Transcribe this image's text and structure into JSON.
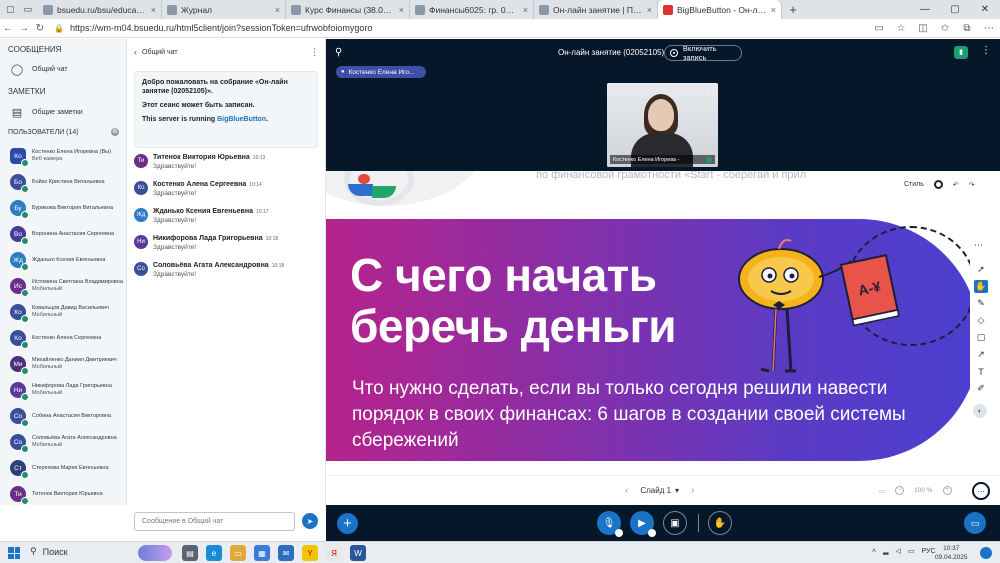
{
  "browser": {
    "tabs": [
      {
        "label": "bsuedu.ru/bsu/education/schedu",
        "active": false
      },
      {
        "label": "Журнал",
        "active": false
      },
      {
        "label": "Курс Финансы (38.03.01 Эконом",
        "active": false
      },
      {
        "label": "Финансы6025: гр. 02052105 | Пе",
        "active": false
      },
      {
        "label": "Он-лайн занятие | Пегас",
        "active": false
      },
      {
        "label": "BigBlueButton - Он-лайн за",
        "active": true
      }
    ],
    "url": "https://wm-m04.bsuedu.ru/html5client/join?sessionToken=ufrwobfoiomygoro"
  },
  "sidebar": {
    "messages_title": "СООБЩЕНИЯ",
    "public_chat": "Общий чат",
    "notes_title": "ЗАМЕТКИ",
    "shared_notes": "Общие заметки",
    "users_title": "ПОЛЬЗОВАТЕЛИ (14)",
    "users": [
      {
        "initials": "Ко",
        "name": "Костенко Елена Игоревна (Вы)",
        "sub": "Веб-камера",
        "color": "#2e4aa8",
        "self": true
      },
      {
        "initials": "Бо",
        "name": "Бойко Кристина Витальевна",
        "sub": "",
        "color": "#3a4e9c"
      },
      {
        "initials": "Бу",
        "name": "Бурикова Виктория Витальевна",
        "sub": "",
        "color": "#2c7cc4"
      },
      {
        "initials": "Во",
        "name": "Воронина Анастасия Сергеевна",
        "sub": "",
        "color": "#4a3a9c"
      },
      {
        "initials": "Жд",
        "name": "Жданько Ксения Евгеньевна",
        "sub": "",
        "color": "#2c7cc4"
      },
      {
        "initials": "Ис",
        "name": "Истомина Светлана Владимировна",
        "sub": "Мобильный",
        "color": "#6b2f88"
      },
      {
        "initials": "Ко",
        "name": "Ковальцов Давид Васильевич",
        "sub": "Мобильный",
        "color": "#3a4e9c"
      },
      {
        "initials": "Ко",
        "name": "Костенко Алена Сергеевна",
        "sub": "",
        "color": "#3a4e9c"
      },
      {
        "initials": "Ми",
        "name": "Михайленко Даниил Дмитриевич",
        "sub": "Мобильный",
        "color": "#4a2f7c"
      },
      {
        "initials": "Ни",
        "name": "Никифорова Лада Григорьевна",
        "sub": "Мобильный",
        "color": "#5b3a9c"
      },
      {
        "initials": "Со",
        "name": "Собина Анастасия Викторовна",
        "sub": "",
        "color": "#3a4e9c"
      },
      {
        "initials": "Со",
        "name": "Соловьёва Агата Александровна",
        "sub": "Мобильный",
        "color": "#3a4e9c"
      },
      {
        "initials": "Ст",
        "name": "Стерехова Мария Евгеньевна",
        "sub": "",
        "color": "#2e3f7c"
      },
      {
        "initials": "Ти",
        "name": "Титенок Виктория Юрьевна",
        "sub": "",
        "color": "#6b2f88"
      }
    ]
  },
  "chat": {
    "title": "Общий чат",
    "welcome_line1": "Добро пожаловать на собрание «Он-лайн занятие (02052105)».",
    "welcome_line2": "Этот сеанс может быть записан.",
    "welcome_line3_prefix": "This server is running",
    "welcome_line3_link": "BigBlueButton",
    "welcome_line3_suffix": ".",
    "messages": [
      {
        "initials": "Ти",
        "name": "Титенок Виктория Юрьевна",
        "time": "10:13",
        "text": "Здравствуйте!",
        "color": "#6b2f88"
      },
      {
        "initials": "Ко",
        "name": "Костенко Алена Сергеевна",
        "time": "10:14",
        "text": "Здравствуйте!",
        "color": "#3a4e9c"
      },
      {
        "initials": "Жд",
        "name": "Жданько Ксения Евгеньевна",
        "time": "10:17",
        "text": "Здравствуйте!",
        "color": "#2c7cc4"
      },
      {
        "initials": "Ни",
        "name": "Никифорова Лада Григорьевна",
        "time": "10:18",
        "text": "Здравствуйте!",
        "color": "#5b3a9c"
      },
      {
        "initials": "Со",
        "name": "Соловьёва Агата Александровна",
        "time": "10:18",
        "text": "Здравствуйте!",
        "color": "#3a4e9c"
      }
    ],
    "input_placeholder": "Сообщение в Общий чат"
  },
  "main": {
    "title": "Он-лайн занятие (02052105)",
    "record_label": "Включить запись",
    "talking": "Костенко Елена Иго...",
    "webcam_label": "Костенко Елена Игорева -"
  },
  "slide": {
    "top_text": "по финансовой грамотности «Start - сберегай и прил",
    "heading_line1": "С чего начать",
    "heading_line2": "беречь деньги",
    "subtitle": "Что нужно сделать, если вы только сегодня решили навести порядок в своих финансах: 6 шагов в создании своей системы сбережений",
    "book_text": "A-¥",
    "style_label": "Стиль",
    "slide_label": "Слайд 1",
    "zoom": "100 %"
  },
  "taskbar": {
    "search": "Поиск",
    "lang": "РУС",
    "time": "10:37",
    "date": "09.04.2025"
  }
}
